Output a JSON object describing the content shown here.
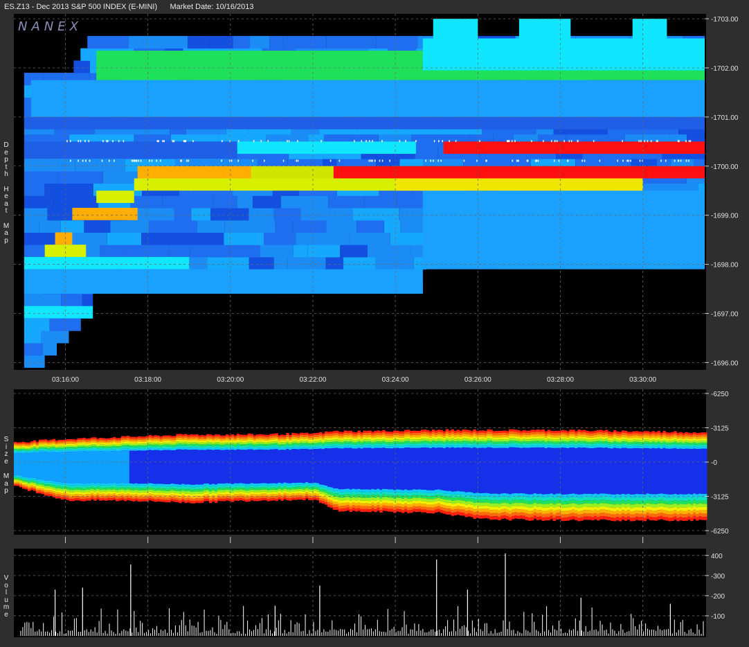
{
  "header": {
    "symbol": "ES.Z13 - Dec 2013 S&P 500 INDEX (E-MINI)",
    "market_date": "Market Date: 10/16/2013"
  },
  "logo": "NANEX",
  "panels": {
    "depth_label": "Depth Heat Map",
    "size_label": "Size Map",
    "volume_label": "Volume"
  },
  "colors": {
    "background": "#000000",
    "frame": "#2e2e2e",
    "grid": "#5a5a5a",
    "heat_low": "#1e66e6",
    "heat_mid": "#14e0ff",
    "heat_green": "#20e060",
    "heat_yellow": "#e6f000",
    "heat_orange": "#ffb000",
    "heat_high": "#ff1010",
    "volume_bar": "#ffffff"
  },
  "chart_data": [
    {
      "type": "heatmap",
      "title": "Depth Heat Map",
      "x_ticks": [
        "03:16:00",
        "03:18:00",
        "03:20:00",
        "03:22:00",
        "03:24:00",
        "03:26:00",
        "03:28:00",
        "03:30:00"
      ],
      "y_ticks": [
        "1703.00",
        "1702.00",
        "1701.00",
        "1700.00",
        "1699.00",
        "1698.00",
        "1697.00",
        "1696.00"
      ],
      "xlim": [
        "03:14:45",
        "03:31:30"
      ],
      "ylim": [
        1695.85,
        1703.1
      ],
      "cell_height": 0.25,
      "bands": [
        {
          "from": "03:16:45",
          "to": "03:24:40",
          "low": 1701.75,
          "high": 1702.35,
          "level": "green"
        },
        {
          "from": "03:24:40",
          "to": "03:31:30",
          "low": 1701.75,
          "high": 1701.95,
          "level": "green"
        },
        {
          "from": "03:24:40",
          "to": "03:31:30",
          "low": 1701.95,
          "high": 1702.6,
          "level": "cyan"
        },
        {
          "from": "03:15:10",
          "to": "03:31:30",
          "low": 1701.0,
          "high": 1701.75,
          "level": "lightblue"
        },
        {
          "from": "03:15:00",
          "to": "03:31:30",
          "low": 1700.75,
          "high": 1701.0,
          "level": "blue"
        },
        {
          "from": "03:15:00",
          "to": "03:20:10",
          "low": 1700.15,
          "high": 1700.5,
          "level": "blue"
        },
        {
          "from": "03:20:10",
          "to": "03:24:30",
          "low": 1700.25,
          "high": 1700.5,
          "level": "cyan"
        },
        {
          "from": "03:25:10",
          "to": "03:31:30",
          "low": 1700.25,
          "high": 1700.5,
          "level": "red"
        },
        {
          "from": "03:17:45",
          "to": "03:22:30",
          "low": 1699.75,
          "high": 1700.0,
          "level": "orange"
        },
        {
          "from": "03:22:30",
          "to": "03:31:30",
          "low": 1699.75,
          "high": 1700.0,
          "level": "red"
        },
        {
          "from": "03:17:40",
          "to": "03:30:00",
          "low": 1699.5,
          "high": 1699.75,
          "level": "yellow"
        },
        {
          "from": "03:16:45",
          "to": "03:17:40",
          "low": 1699.25,
          "high": 1699.5,
          "level": "yellow"
        },
        {
          "from": "03:16:10",
          "to": "03:17:45",
          "low": 1698.9,
          "high": 1699.15,
          "level": "orange"
        },
        {
          "from": "03:15:45",
          "to": "03:16:10",
          "low": 1698.4,
          "high": 1698.65,
          "level": "orange"
        },
        {
          "from": "03:15:30",
          "to": "03:16:30",
          "low": 1698.15,
          "high": 1698.4,
          "level": "yellow"
        },
        {
          "from": "03:15:00",
          "to": "03:19:00",
          "low": 1697.9,
          "high": 1698.15,
          "level": "cyan"
        },
        {
          "from": "03:15:00",
          "to": "03:24:40",
          "low": 1697.4,
          "high": 1697.9,
          "level": "lightblue"
        },
        {
          "from": "03:24:40",
          "to": "03:31:30",
          "low": 1697.9,
          "high": 1699.5,
          "level": "lightblue"
        },
        {
          "from": "03:15:00",
          "to": "03:16:45",
          "low": 1696.9,
          "high": 1697.15,
          "level": "cyan"
        }
      ]
    },
    {
      "type": "area",
      "title": "Size Map",
      "y_ticks": [
        "6250",
        "3125",
        "0",
        "-3125",
        "-6250"
      ],
      "ylim": [
        -6250,
        6250
      ],
      "x": [
        "03:14:45",
        "03:16:00",
        "03:17:30",
        "03:19:00",
        "03:20:30",
        "03:22:00",
        "03:22:30",
        "03:23:00",
        "03:25:00",
        "03:26:00",
        "03:28:00",
        "03:31:30"
      ],
      "upper": [
        1800,
        2100,
        2300,
        2500,
        2500,
        2600,
        2800,
        2800,
        2900,
        2900,
        2900,
        2700
      ],
      "lower": [
        -2200,
        -3500,
        -3500,
        -3700,
        -3500,
        -3400,
        -4400,
        -4500,
        -4600,
        -5200,
        -5300,
        -5300
      ]
    },
    {
      "type": "bar",
      "title": "Volume",
      "y_ticks": [
        "400",
        "300",
        "200",
        "100"
      ],
      "ylim": [
        0,
        420
      ],
      "x_range": [
        "03:14:45",
        "03:31:30"
      ],
      "peaks": [
        {
          "t": "03:15:45",
          "v": 230
        },
        {
          "t": "03:16:25",
          "v": 240
        },
        {
          "t": "03:17:35",
          "v": 355
        },
        {
          "t": "03:21:05",
          "v": 150
        },
        {
          "t": "03:22:10",
          "v": 250
        },
        {
          "t": "03:25:00",
          "v": 380
        },
        {
          "t": "03:25:45",
          "v": 230
        },
        {
          "t": "03:26:40",
          "v": 410
        },
        {
          "t": "03:28:30",
          "v": 190
        },
        {
          "t": "03:30:40",
          "v": 160
        }
      ]
    }
  ]
}
